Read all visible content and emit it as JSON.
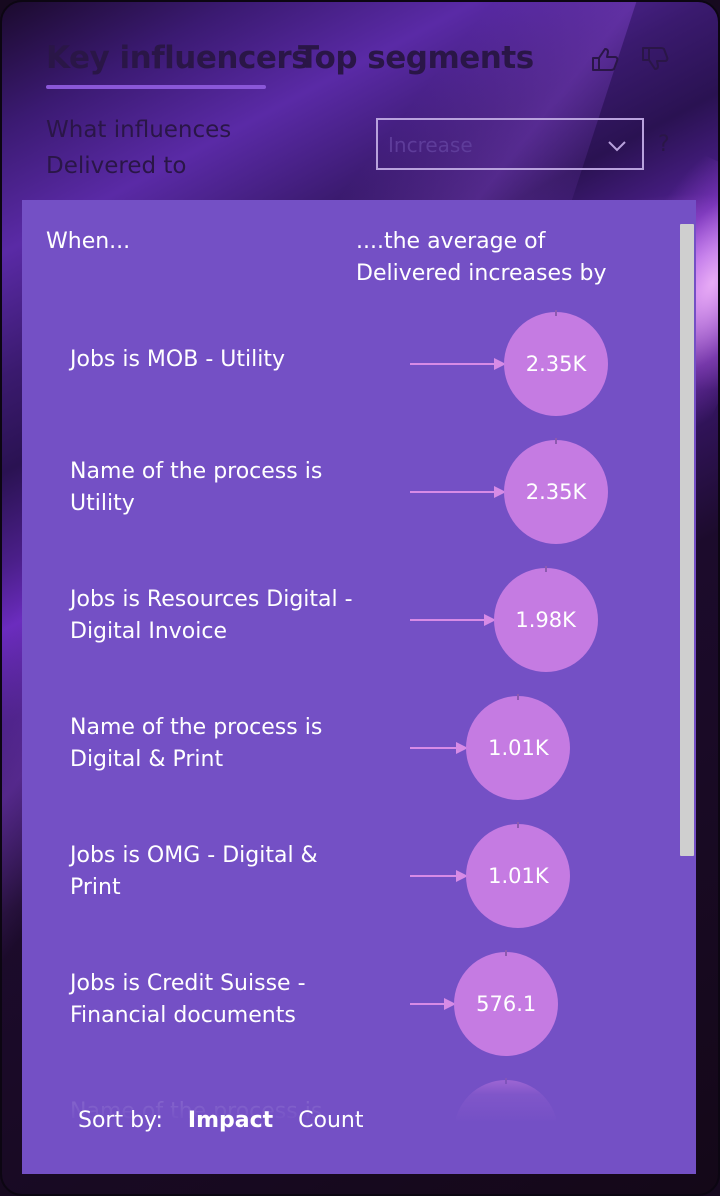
{
  "tabs": {
    "key_influencers": "Key influencers",
    "top_segments": "Top segments"
  },
  "question": "What influences Delivered to",
  "dropdown": {
    "value": "Increase"
  },
  "help_label": "?",
  "columns": {
    "when": "When...",
    "average": "....the average of Delivered increases by"
  },
  "influencers": [
    {
      "label": "Jobs is MOB - Utility",
      "value": "2.35K",
      "impact": 2350
    },
    {
      "label": "Name of the process is Utility",
      "value": "2.35K",
      "impact": 2350
    },
    {
      "label": "Jobs is Resources Digital - Digital Invoice",
      "value": "1.98K",
      "impact": 1980
    },
    {
      "label": "Name of the process is Digital & Print",
      "value": "1.01K",
      "impact": 1010
    },
    {
      "label": "Jobs is OMG - Digital & Print",
      "value": "1.01K",
      "impact": 1010
    },
    {
      "label": "Jobs is Credit Suisse - Financial documents",
      "value": "576.1",
      "impact": 576.1
    },
    {
      "label": "Name of the process is Real",
      "value": "",
      "impact": 560
    }
  ],
  "sort": {
    "label": "Sort by:",
    "impact": "Impact",
    "count": "Count"
  },
  "colors": {
    "panel": "#7450c5",
    "bubble": "#c57be2",
    "connector": "#d78be6",
    "tab_underline": "#8a57d8"
  },
  "icons": {
    "like": "thumbs-up-icon",
    "dislike": "thumbs-down-icon",
    "dropdown": "chevron-down-icon"
  }
}
